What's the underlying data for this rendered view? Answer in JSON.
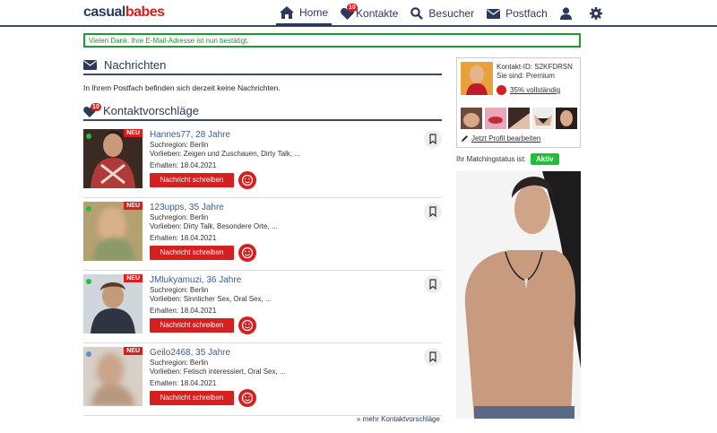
{
  "header": {
    "logo_part1": "casual",
    "logo_part2": "babes",
    "nav": [
      {
        "label": "Home",
        "icon": "home-icon"
      },
      {
        "label": "Kontakte",
        "icon": "heart-icon",
        "badge": "10"
      },
      {
        "label": "Besucher",
        "icon": "search-icon"
      },
      {
        "label": "Postfach",
        "icon": "envelope-icon"
      }
    ],
    "user_icon": "user-icon",
    "settings_icon": "gear-icon"
  },
  "flash": "Vielen Dank. Ihre E-Mail-Adresse ist nun bestätigt.",
  "messages": {
    "title": "Nachrichten",
    "empty_text": "In Ihrem Postfach befinden sich derzeit keine Nachrichten."
  },
  "suggestions": {
    "title": "Kontaktvorschläge",
    "badge": "10",
    "neu_label": "NEU",
    "button_label": "Nachricht schreiben",
    "contacts": [
      {
        "name": "Hannes77, 28 Jahre",
        "region": "Suchregion: Berlin",
        "likes": "Vorlieben: Zeigen und Zuschauen, Dirty Talk, ...",
        "received": "Erhalten: 18.04.2021",
        "status": "online"
      },
      {
        "name": "123upps, 35 Jahre",
        "region": "Suchregion: Berlin",
        "likes": "Vorlieben: Dirty Talk, Besondere Orte, ...",
        "received": "Erhalten: 18.04.2021",
        "status": "online"
      },
      {
        "name": "JMlukyamuzi, 36 Jahre",
        "region": "Suchregion: Berlin",
        "likes": "Vorlieben: Sinnlicher Sex, Oral Sex, ...",
        "received": "Erhalten: 18.04.2021",
        "status": "online"
      },
      {
        "name": "Geilo2468, 35 Jahre",
        "region": "Suchregion: Berlin",
        "likes": "Vorlieben: Fetisch interessiert, Oral Sex, ...",
        "received": "Erhalten: 18.04.2021",
        "status": "away"
      }
    ],
    "more_link": "» mehr Kontaktvorschläge"
  },
  "profile": {
    "contact_id": "Kontakt-ID: S2KFDRSN",
    "membership": "Sie sind: Premium",
    "completeness": "35% vollständig",
    "edit_link": "Jetzt Profil bearbeiten",
    "match_label": "Ihr Matchingstatus ist:",
    "match_status": "Aktiv"
  },
  "colors": {
    "navy": "#2b3a5c",
    "red": "#d62020",
    "green": "#1f9a2c",
    "online": "#1fbf3a",
    "away": "#5b8fd6"
  }
}
